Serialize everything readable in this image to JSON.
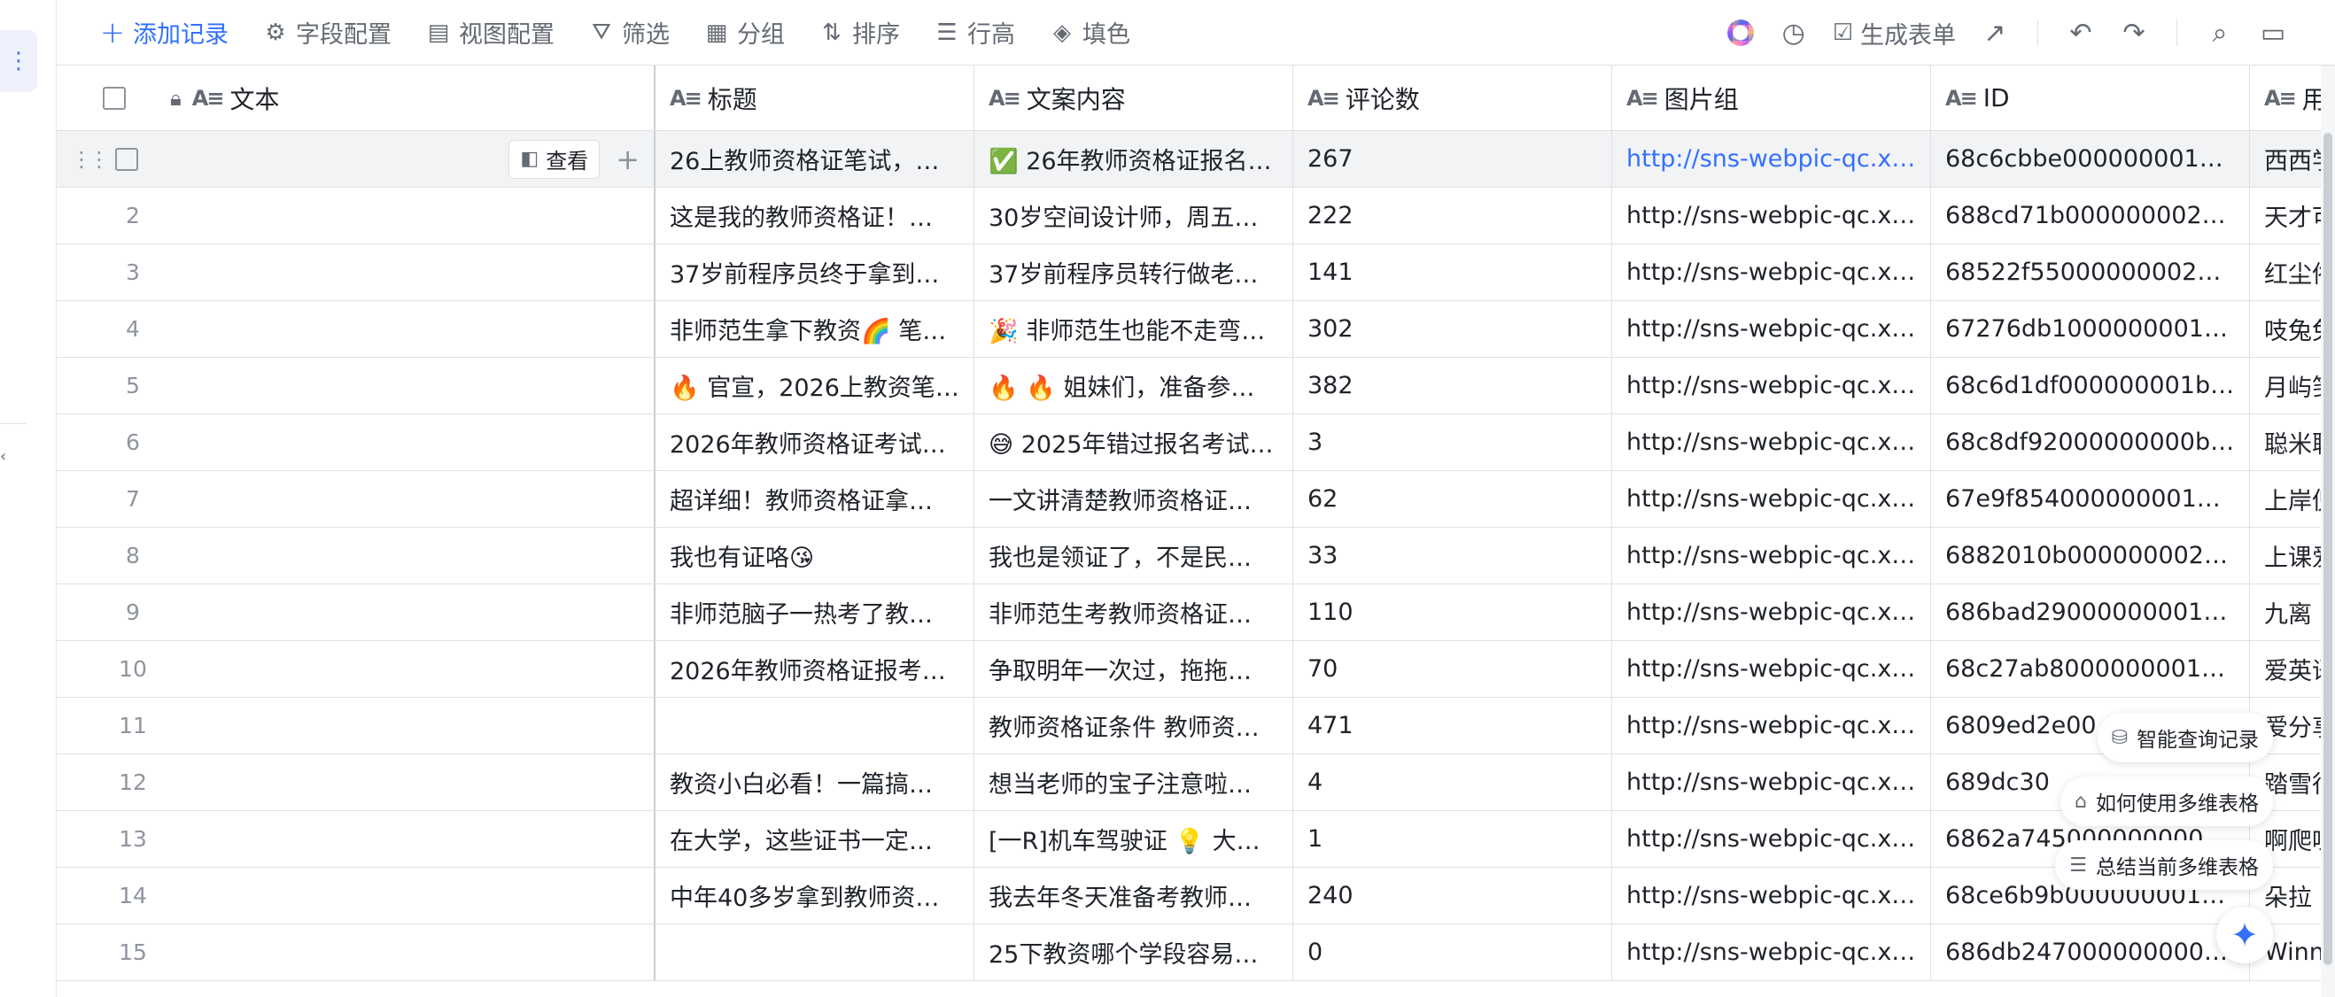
{
  "toolbar": {
    "add_record": "添加记录",
    "field_config": "字段配置",
    "view_config": "视图配置",
    "filter": "筛选",
    "group": "分组",
    "sort": "排序",
    "row_height": "行高",
    "fill_color": "填色",
    "generate_form": "生成表单"
  },
  "table": {
    "columns": [
      "文本",
      "标题",
      "文案内容",
      "评论数",
      "图片组",
      "ID",
      "用户"
    ],
    "view_button": "查看",
    "rows": [
      {
        "num": "1",
        "title": "26上教师资格证笔试，…",
        "content": "✅ 26年教师资格证报名…",
        "comments": "267",
        "images": "http://sns-webpic-qc.x…",
        "id": "68c6cbbe000000001d…",
        "user": "西西学"
      },
      {
        "num": "2",
        "title": "这是我的教师资格证！…",
        "content": "30岁空间设计师，周五…",
        "comments": "222",
        "images": "http://sns-webpic-qc.x…",
        "id": "688cd71b0000000025…",
        "user": "天才可"
      },
      {
        "num": "3",
        "title": "37岁前程序员终于拿到…",
        "content": "37岁前程序员转行做老…",
        "comments": "141",
        "images": "http://sns-webpic-qc.x…",
        "id": "68522f550000000021…",
        "user": "红尘俗"
      },
      {
        "num": "4",
        "title": "非师范生拿下教资🌈 笔…",
        "content": "🎉 非师范生也能不走弯…",
        "comments": "302",
        "images": "http://sns-webpic-qc.x…",
        "id": "67276db1000000001b…",
        "user": "吱兔兔"
      },
      {
        "num": "5",
        "title": "🔥 官宣，2026上教资笔…",
        "content": "🔥 🔥 姐妹们，准备参加…",
        "comments": "382",
        "images": "http://sns-webpic-qc.x…",
        "id": "68c6d1df000000001b…",
        "user": "月屿笺"
      },
      {
        "num": "6",
        "title": "2026年教师资格证考试…",
        "content": "😅 2025年错过报名考试…",
        "comments": "3",
        "images": "http://sns-webpic-qc.x…",
        "id": "68c8df92000000000b…",
        "user": "聪米聪"
      },
      {
        "num": "7",
        "title": "超详细！教师资格证拿…",
        "content": "一文讲清楚教师资格证…",
        "comments": "62",
        "images": "http://sns-webpic-qc.x…",
        "id": "67e9f854000000001d…",
        "user": "上岸倪"
      },
      {
        "num": "8",
        "title": "我也有证咯😘",
        "content": "我也是领证了，不是民…",
        "comments": "33",
        "images": "http://sns-webpic-qc.x…",
        "id": "6882010b000000002…",
        "user": "上课爱"
      },
      {
        "num": "9",
        "title": "非师范脑子一热考了教…",
        "content": "非师范生考教师资格证…",
        "comments": "110",
        "images": "http://sns-webpic-qc.x…",
        "id": "686bad290000000012…",
        "user": "九离"
      },
      {
        "num": "10",
        "title": "2026年教师资格证报考…",
        "content": "争取明年一次过，拖拖…",
        "comments": "70",
        "images": "http://sns-webpic-qc.x…",
        "id": "68c27ab8000000001b…",
        "user": "爱英语"
      },
      {
        "num": "11",
        "title": "",
        "content": "教师资格证条件 教师资…",
        "comments": "471",
        "images": "http://sns-webpic-qc.x…",
        "id": "6809ed2e00",
        "user": "爱分享"
      },
      {
        "num": "12",
        "title": "教资小白必看！一篇搞…",
        "content": "想当老师的宝子注意啦…",
        "comments": "4",
        "images": "http://sns-webpic-qc.x…",
        "id": "689dc30",
        "user": "踏雪行"
      },
      {
        "num": "13",
        "title": "在大学，这些证书一定…",
        "content": "[一R]机车驾驶证 💡 大…",
        "comments": "1",
        "images": "http://sns-webpic-qc.x…",
        "id": "6862a745000000000",
        "user": "啊爬哇"
      },
      {
        "num": "14",
        "title": "中年40多岁拿到教师资…",
        "content": "我去年冬天准备考教师…",
        "comments": "240",
        "images": "http://sns-webpic-qc.x…",
        "id": "68ce6b9b0000000012…",
        "user": "朵拉"
      },
      {
        "num": "15",
        "title": "",
        "content": "25下教资哪个学段容易…",
        "comments": "0",
        "images": "http://sns-webpic-qc.x…",
        "id": "686db247000000000…",
        "user": "Winni"
      }
    ]
  },
  "assistant": {
    "smart_query": "智能查询记录",
    "how_to_use": "如何使用多维表格",
    "summarize": "总结当前多维表格"
  },
  "colors": {
    "accent": "#3370ff",
    "border": "#dee0e3",
    "selected_row": "#f2f3f5"
  }
}
